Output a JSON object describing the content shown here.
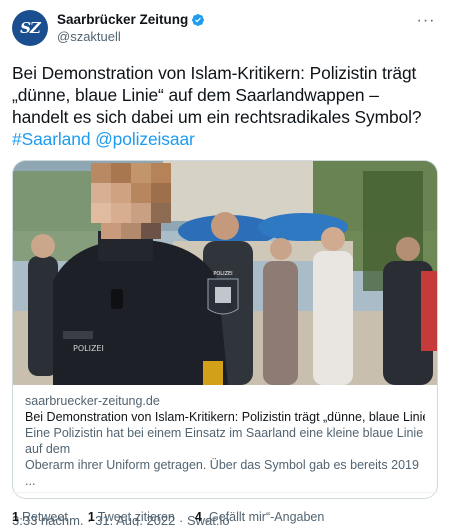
{
  "account": {
    "avatar_text": "SZ",
    "display_name": "Saarbrücker Zeitung",
    "handle": "@szaktuell",
    "verified_color": "#1d9bf0"
  },
  "more_label": "···",
  "tweet": {
    "line1": "Bei Demonstration von Islam-Kritikern: Polizistin trägt",
    "line2": "„dünne, blaue Linie“ auf dem Saarlandwappen –",
    "line3": "handelt es sich dabei um ein rechtsradikales Symbol?",
    "hashtag": "#Saarland",
    "mention": "@polizeisaar"
  },
  "card": {
    "image_alt": "Polizistin in Uniform mit verpixeltem Gesicht bei einer Demonstration",
    "patch_text": "POLIZEI",
    "vest_text": "POLIZEI",
    "domain": "saarbruecker-zeitung.de",
    "title": "Bei Demonstration von Islam-Kritikern: Polizistin trägt „dünne, blaue Linie“ auf ...",
    "description_line1": "Eine Polizistin hat bei einem Einsatz im Saarland eine kleine blaue Linie auf dem",
    "description_line2": "Oberarm ihrer Uniform getragen. Über das Symbol gab es bereits 2019 ..."
  },
  "meta": {
    "time": "3:33 nachm.",
    "date": "31. Aug. 2022",
    "source": "Swat.io",
    "separator": "·"
  },
  "stats": {
    "retweets_count": "1",
    "retweets_label": "Retweet",
    "quotes_count": "1",
    "quotes_label": "Tweet zitieren",
    "likes_count": "4",
    "likes_label": "„Gefällt mir“-Angaben"
  },
  "colors": {
    "link": "#1d9bf0",
    "secondary_text": "#536471",
    "border": "#cfd9de"
  }
}
